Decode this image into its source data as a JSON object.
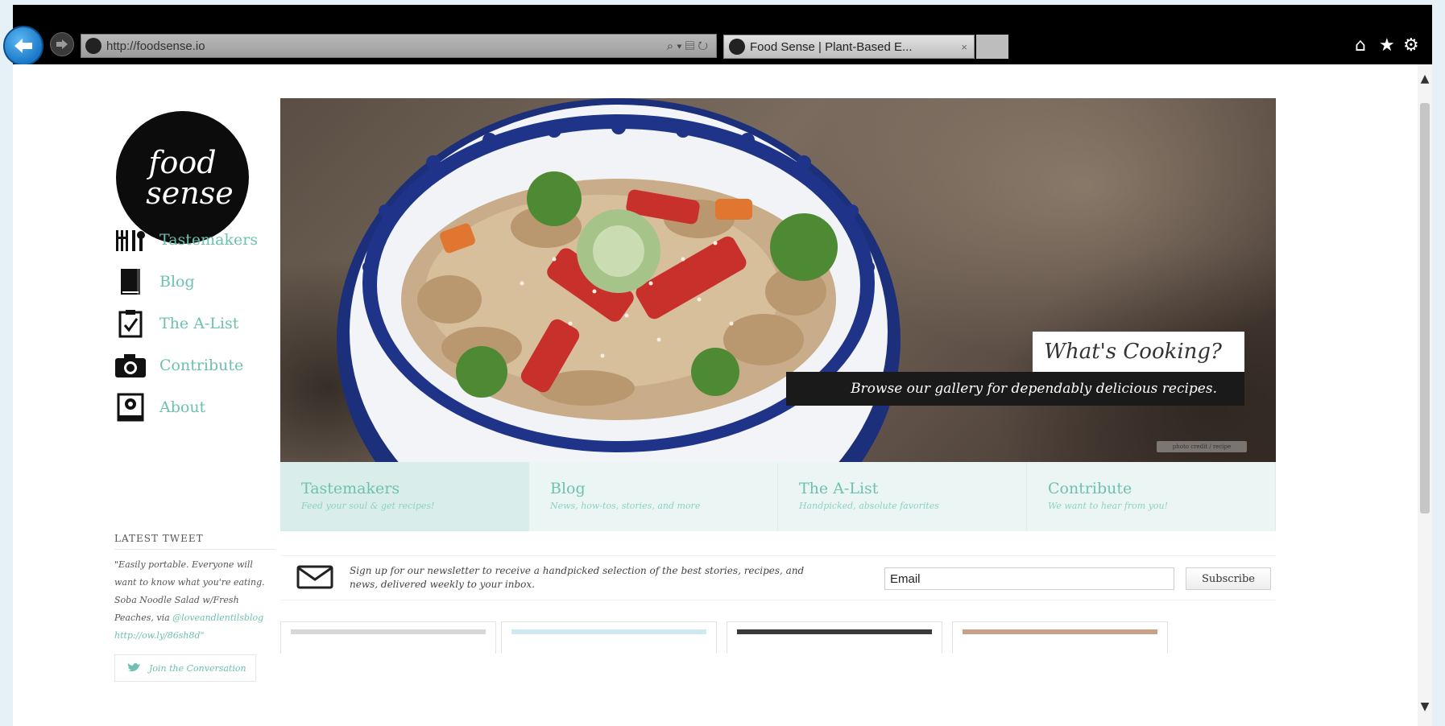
{
  "browser": {
    "url": "http://foodsense.io",
    "tab_title": "Food Sense | Plant-Based E...",
    "tab_close": "×",
    "addr_tools": "⌕ ▾ ▤ ↻",
    "icons": [
      "back-arrow-icon",
      "forward-arrow-icon",
      "home-icon",
      "favorites-star-icon",
      "settings-gear-icon"
    ]
  },
  "site": {
    "logo_line1": "food",
    "logo_line2": "sense",
    "nav": [
      {
        "label": "Tastemakers",
        "icon": "utensils-icon"
      },
      {
        "label": "Blog",
        "icon": "book-icon"
      },
      {
        "label": "The A-List",
        "icon": "clipboard-check-icon"
      },
      {
        "label": "Contribute",
        "icon": "camera-icon"
      },
      {
        "label": "About",
        "icon": "profile-card-icon"
      }
    ],
    "tweet": {
      "heading": "LATEST TWEET",
      "text": "\"Easily portable. Everyone will want to know what you're eating. Soba Noodle Salad w/Fresh Peaches, via",
      "handle": "@loveandlentilsblog",
      "link": "http://ow.ly/86sh8d\"",
      "join": "Join the Conversation"
    }
  },
  "hero": {
    "title": "What's Cooking?",
    "subtitle": "Browse our gallery for dependably delicious recipes.",
    "credit": "photo credit / recipe"
  },
  "feature_tabs": [
    {
      "title": "Tastemakers",
      "desc": "Feed your soul & get recipes!"
    },
    {
      "title": "Blog",
      "desc": "News, how-tos, stories, and more"
    },
    {
      "title": "The A-List",
      "desc": "Handpicked, absolute favorites"
    },
    {
      "title": "Contribute",
      "desc": "We want to hear from you!"
    }
  ],
  "newsletter": {
    "text": "Sign up for our newsletter to receive a handpicked selection of the best stories, recipes, and news, delivered weekly to your inbox.",
    "email_value": "Email",
    "subscribe": "Subscribe"
  },
  "colors": {
    "accent": "#6ec0b1",
    "tab_bg": "#ebf6f4",
    "dark": "#1a1a1a"
  }
}
